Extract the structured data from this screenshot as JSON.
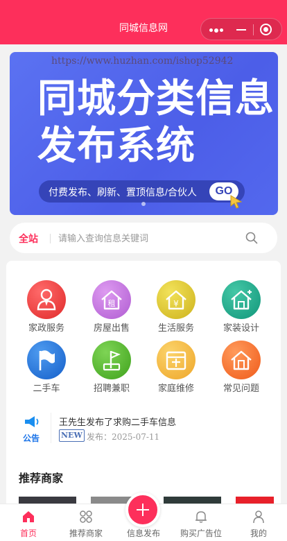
{
  "header": {
    "title": "同城信息网"
  },
  "banner": {
    "watermark": "https://www.huzhan.com/ishop52942",
    "headline1": "同城分类信息",
    "headline2": "发布系统",
    "tagline": "付费发布、刷新、置顶信息/合伙人",
    "cta": "GO"
  },
  "search": {
    "scope": "全站",
    "placeholder": "请输入查询信息关键词",
    "value": ""
  },
  "categories": [
    {
      "label": "家政服务",
      "icon": "housekeeping-icon",
      "color": "#f0393a"
    },
    {
      "label": "房屋出售",
      "icon": "house-rent-icon",
      "color": "#c06ed9"
    },
    {
      "label": "生活服务",
      "icon": "life-service-icon",
      "color": "#d9c22a"
    },
    {
      "label": "家装设计",
      "icon": "home-design-icon",
      "color": "#1fa88a"
    },
    {
      "label": "二手车",
      "icon": "flag-icon",
      "color": "#1f6fd6"
    },
    {
      "label": "招聘兼职",
      "icon": "recruit-icon",
      "color": "#55b62e"
    },
    {
      "label": "家庭维修",
      "icon": "repair-icon",
      "color": "#f2b43a"
    },
    {
      "label": "常见问题",
      "icon": "faq-icon",
      "color": "#f46a2a"
    }
  ],
  "notice": {
    "label": "公告",
    "text": "王先生发布了求购二手车信息",
    "badge": "NEW",
    "date": "发布：2025-07-11"
  },
  "merchants": {
    "title": "推荐商家"
  },
  "tabbar": [
    {
      "label": "首页",
      "icon": "home-icon",
      "active": true
    },
    {
      "label": "推荐商家",
      "icon": "merchants-icon",
      "active": false
    },
    {
      "label": "信息发布",
      "icon": "add-icon",
      "active": false
    },
    {
      "label": "购买广告位",
      "icon": "bell-icon",
      "active": false
    },
    {
      "label": "我的",
      "icon": "user-icon",
      "active": false
    }
  ],
  "colors": {
    "brand": "#fd2f5b",
    "banner": "#5b72f2",
    "notice": "#1a73e8"
  }
}
